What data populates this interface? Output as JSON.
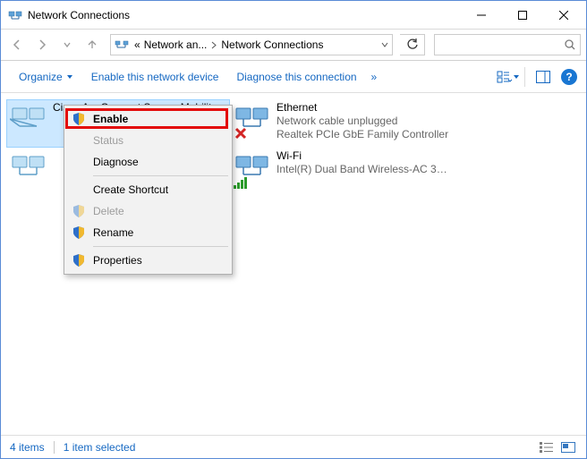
{
  "window": {
    "title": "Network Connections"
  },
  "breadcrumb": {
    "seg1": "Network an...",
    "seg2": "Network Connections"
  },
  "search": {
    "placeholder": ""
  },
  "cmdbar": {
    "organize": "Organize",
    "enable": "Enable this network device",
    "diagnose": "Diagnose this connection",
    "overflow": "»"
  },
  "connections": [
    {
      "name": "Cisco AnyConnect Secure Mobility...",
      "status": "",
      "device": "",
      "selected": true,
      "icon": "net",
      "overlay": "disabled"
    },
    {
      "name": "Ethernet",
      "status": "Network cable unplugged",
      "device": "Realtek PCIe GbE Family Controller",
      "selected": false,
      "icon": "net",
      "overlay": "error"
    },
    {
      "name": "",
      "status": "",
      "device": "",
      "selected": false,
      "icon": "net",
      "overlay": "disabled"
    },
    {
      "name": "Wi-Fi",
      "status": "",
      "device": "Intel(R) Dual Band Wireless-AC 31...",
      "selected": false,
      "icon": "wifi",
      "overlay": "signal"
    }
  ],
  "context_menu": {
    "enable": "Enable",
    "status": "Status",
    "diagnose": "Diagnose",
    "create_shortcut": "Create Shortcut",
    "delete": "Delete",
    "rename": "Rename",
    "properties": "Properties"
  },
  "statusbar": {
    "count": "4 items",
    "selected": "1 item selected"
  }
}
